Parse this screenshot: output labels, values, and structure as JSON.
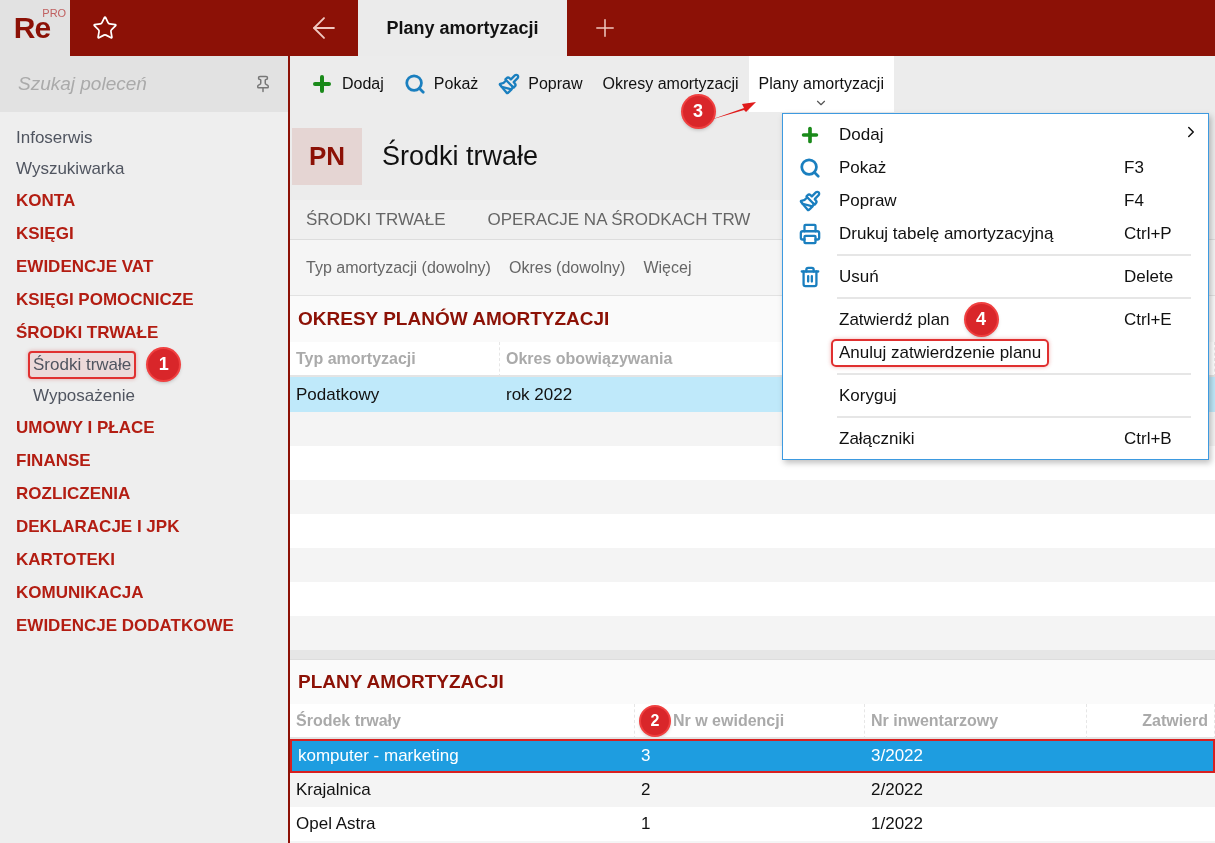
{
  "logo": {
    "text": "Re",
    "super": "PRO"
  },
  "top_tabs": [
    {
      "label": "Plany amortyzacji",
      "selected": true
    }
  ],
  "sidebar": {
    "search": {
      "placeholder": "Szukaj poleceń"
    },
    "items": [
      {
        "label": "Infoserwis",
        "kind": "link"
      },
      {
        "label": "Wyszukiwarka",
        "kind": "link"
      },
      {
        "label": "KONTA",
        "kind": "group"
      },
      {
        "label": "KSIĘGI",
        "kind": "group"
      },
      {
        "label": "EWIDENCJE VAT",
        "kind": "group"
      },
      {
        "label": "KSIĘGI POMOCNICZE",
        "kind": "group"
      },
      {
        "label": "ŚRODKI TRWAŁE",
        "kind": "group",
        "children": [
          {
            "label": "Środki trwałe",
            "selected": true,
            "badge": "1"
          },
          {
            "label": "Wyposażenie",
            "selected": false
          }
        ]
      },
      {
        "label": "UMOWY I PŁACE",
        "kind": "group"
      },
      {
        "label": "FINANSE",
        "kind": "group"
      },
      {
        "label": "ROZLICZENIA",
        "kind": "group"
      },
      {
        "label": "DEKLARACJE I JPK",
        "kind": "group"
      },
      {
        "label": "KARTOTEKI",
        "kind": "group"
      },
      {
        "label": "KOMUNIKACJA",
        "kind": "group"
      },
      {
        "label": "EWIDENCJE DODATKOWE",
        "kind": "group"
      }
    ]
  },
  "toolbar": [
    {
      "label": "Dodaj",
      "selected": false
    },
    {
      "label": "Pokaż",
      "selected": false
    },
    {
      "label": "Popraw",
      "selected": false
    },
    {
      "label": "Okresy amortyzacji",
      "selected": false
    },
    {
      "label": "Plany amortyzacji",
      "selected": true,
      "badge": "3"
    }
  ],
  "header": {
    "badge": "PN",
    "title": "Środki trwałe"
  },
  "tabs": [
    {
      "label": "ŚRODKI TRWAŁE"
    },
    {
      "label": "OPERACJE NA ŚRODKACH TRW"
    }
  ],
  "filters": [
    "Typ amortyzacji (dowolny)",
    "Okres (dowolny)",
    "Więcej"
  ],
  "tables": [
    {
      "title": "OKRESY PLANÓW AMORTYZACJI",
      "focused": false,
      "columns": [
        "Typ amortyzacji",
        "Okres obowiązywania"
      ],
      "rows": [
        {
          "cells": [
            "Podatkowy",
            "rok 2022"
          ],
          "selected": true
        }
      ]
    },
    {
      "title": "PLANY AMORTYZACJI",
      "focused": true,
      "columns": [
        "Środek trwały",
        "Nr w ewidencji",
        "Nr inwentarzowy",
        "Zatwierd"
      ],
      "header_badge": "2",
      "rows": [
        {
          "cells": [
            "komputer - marketing",
            "3",
            "3/2022",
            ""
          ],
          "selected": true
        },
        {
          "cells": [
            "Krajalnica",
            "2",
            "2/2022",
            ""
          ],
          "selected": false
        },
        {
          "cells": [
            "Opel Astra",
            "1",
            "1/2022",
            ""
          ],
          "selected": false
        }
      ]
    }
  ],
  "menu": [
    {
      "kind": "command",
      "label": "Dodaj",
      "submenu": true
    },
    {
      "kind": "command",
      "label": "Pokaż",
      "shortcut": "F3"
    },
    {
      "kind": "command",
      "label": "Popraw",
      "shortcut": "F4"
    },
    {
      "kind": "command",
      "label": "Drukuj tabelę amortyzacyjną",
      "shortcut": "Ctrl+P"
    },
    {
      "kind": "separator"
    },
    {
      "kind": "command",
      "label": "Usuń",
      "shortcut": "Delete"
    },
    {
      "kind": "separator"
    },
    {
      "kind": "command",
      "label": "Zatwierdź plan",
      "shortcut": "Ctrl+E",
      "badge": "4"
    },
    {
      "kind": "command",
      "label": "Anuluj zatwierdzenie planu",
      "highlighted": true
    },
    {
      "kind": "separator"
    },
    {
      "kind": "command",
      "label": "Koryguj"
    },
    {
      "kind": "separator"
    },
    {
      "kind": "command",
      "label": "Załączniki",
      "shortcut": "Ctrl+B"
    }
  ]
}
